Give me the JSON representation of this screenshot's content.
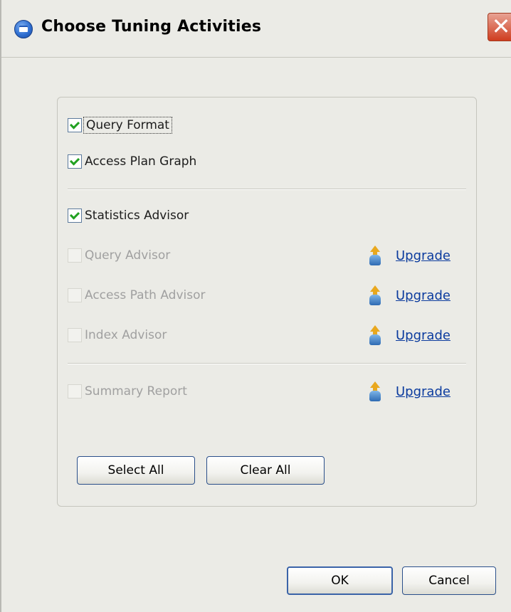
{
  "window": {
    "title": "Choose Tuning Activities",
    "close_glyph": "✕"
  },
  "options": {
    "query_format": {
      "label": "Query Format",
      "checked": true
    },
    "access_plan_graph": {
      "label": "Access Plan Graph",
      "checked": true
    },
    "statistics_advisor": {
      "label": "Statistics Advisor",
      "checked": true
    },
    "query_advisor": {
      "label": "Query Advisor",
      "checked": false,
      "enabled": false,
      "upgrade_label": "Upgrade"
    },
    "access_path_advisor": {
      "label": "Access Path Advisor",
      "checked": false,
      "enabled": false,
      "upgrade_label": "Upgrade"
    },
    "index_advisor": {
      "label": "Index Advisor",
      "checked": false,
      "enabled": false,
      "upgrade_label": "Upgrade"
    },
    "summary_report": {
      "label": "Summary Report",
      "checked": false,
      "enabled": false,
      "upgrade_label": "Upgrade"
    }
  },
  "group_buttons": {
    "select_all": "Select All",
    "clear_all": "Clear All"
  },
  "dialog_buttons": {
    "ok": "OK",
    "cancel": "Cancel"
  },
  "colors": {
    "window_bg": "#ebebe6",
    "check_mark": "#21a121",
    "link": "#0b3b9e",
    "disabled_text": "#a0a0a0",
    "close_button": "#cf3d1f"
  },
  "icons": {
    "app": "window-app-icon",
    "close": "close-icon",
    "upgrade": "upgrade-arrow-icon",
    "check": "checkmark-icon"
  }
}
